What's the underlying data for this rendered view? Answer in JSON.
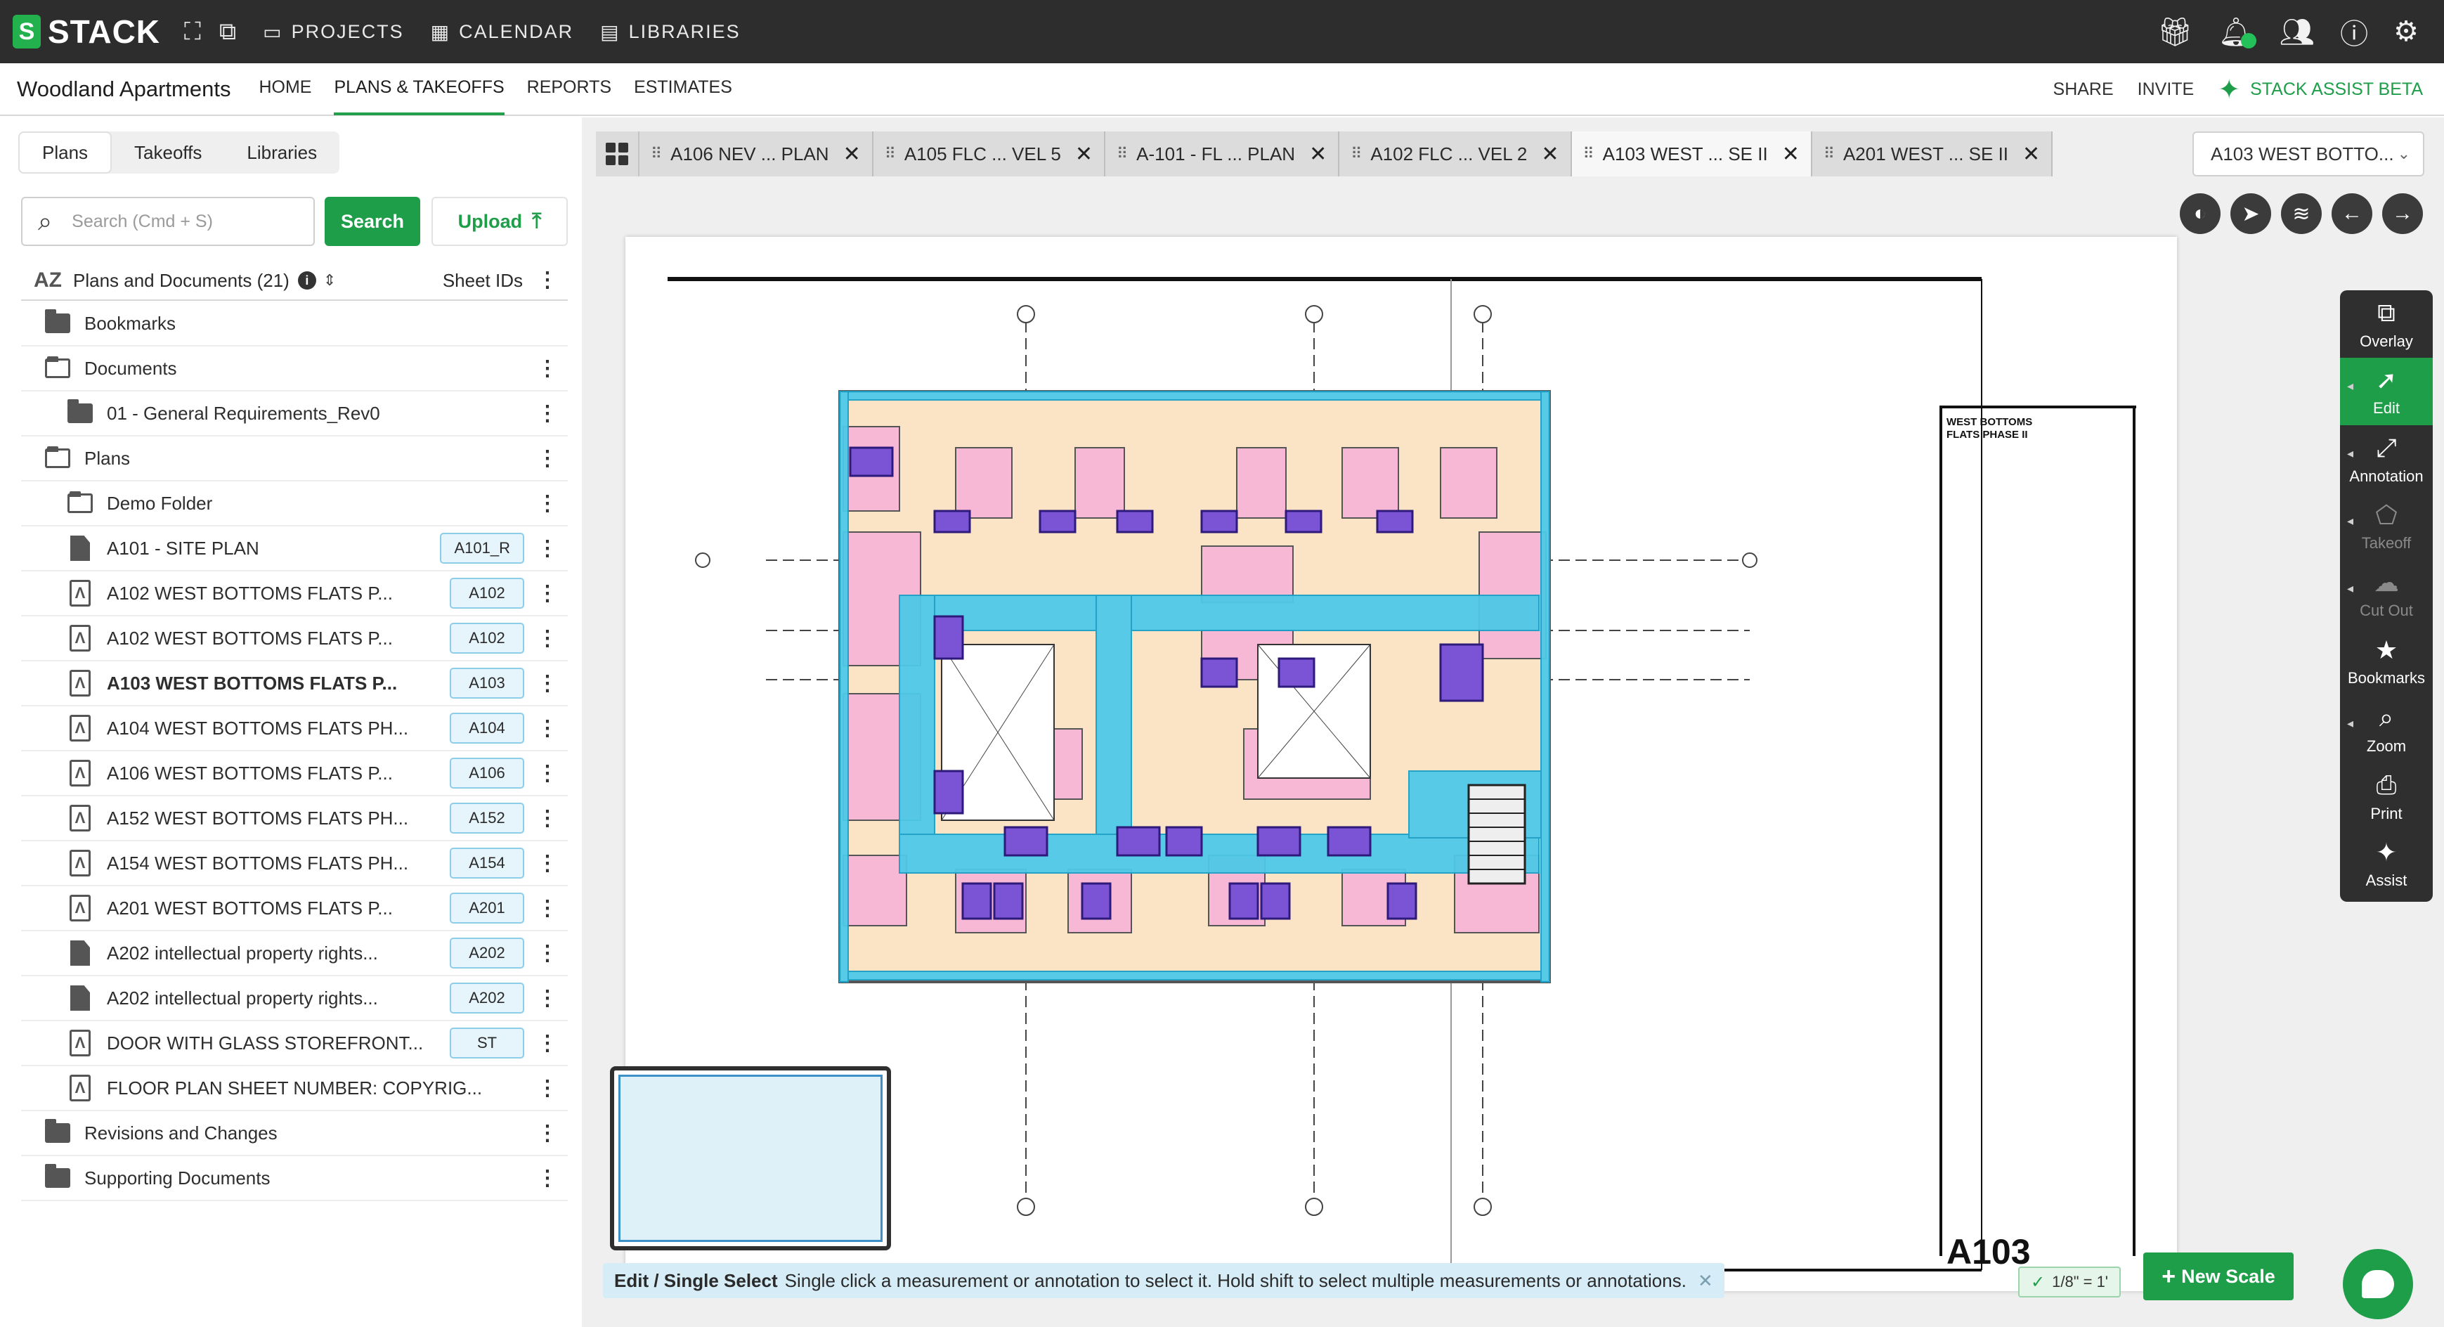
{
  "brand": {
    "logo_text": "STACK",
    "accent": "#1f9e4a",
    "nav_bg": "#2d2d2d"
  },
  "topnav": {
    "items": [
      {
        "label": "PROJECTS",
        "icon": "briefcase-icon"
      },
      {
        "label": "CALENDAR",
        "icon": "calendar-icon"
      },
      {
        "label": "LIBRARIES",
        "icon": "book-icon"
      }
    ],
    "right_icons": [
      "gift-icon",
      "bell-icon",
      "users-icon",
      "help-icon",
      "user-settings-icon"
    ]
  },
  "subbar": {
    "project_title": "Woodland Apartments",
    "tabs": [
      "HOME",
      "PLANS & TAKEOFFS",
      "REPORTS",
      "ESTIMATES"
    ],
    "active_tab": "PLANS & TAKEOFFS",
    "share": "SHARE",
    "invite": "INVITE",
    "assist": "STACK ASSIST BETA"
  },
  "left": {
    "tabs": [
      "Plans",
      "Takeoffs",
      "Libraries"
    ],
    "active_tab": "Plans",
    "search_placeholder": "Search (Cmd + S)",
    "search_button": "Search",
    "upload_button": "Upload",
    "list_title": "Plans and Documents (21)",
    "sheet_ids_label": "Sheet IDs",
    "rows": [
      {
        "label": "Bookmarks",
        "type": "folder",
        "indent": 1,
        "kebab": false
      },
      {
        "label": "Documents",
        "type": "folder-open",
        "indent": 1,
        "kebab": true
      },
      {
        "label": "01 - General Requirements_Rev0",
        "type": "folder",
        "indent": 2,
        "kebab": true
      },
      {
        "label": "Plans",
        "type": "folder-open",
        "indent": 1,
        "kebab": true
      },
      {
        "label": "Demo Folder",
        "type": "folder-open",
        "indent": 2,
        "kebab": true
      },
      {
        "label": "A101 - SITE PLAN",
        "type": "page",
        "indent": 2,
        "badge": "A101_R",
        "kebab": true
      },
      {
        "label": "A102 WEST BOTTOMS FLATS P...",
        "type": "plan",
        "indent": 2,
        "badge": "A102",
        "kebab": true
      },
      {
        "label": "A102 WEST BOTTOMS FLATS P...",
        "type": "plan",
        "indent": 2,
        "badge": "A102",
        "kebab": true
      },
      {
        "label": "A103 WEST BOTTOMS FLATS P...",
        "type": "plan",
        "indent": 2,
        "badge": "A103",
        "kebab": true,
        "bold": true
      },
      {
        "label": "A104 WEST BOTTOMS FLATS PH...",
        "type": "plan",
        "indent": 2,
        "badge": "A104",
        "kebab": true
      },
      {
        "label": "A106 WEST BOTTOMS FLATS P...",
        "type": "plan",
        "indent": 2,
        "badge": "A106",
        "kebab": true
      },
      {
        "label": "A152 WEST BOTTOMS FLATS PH...",
        "type": "plan",
        "indent": 2,
        "badge": "A152",
        "kebab": true
      },
      {
        "label": "A154 WEST BOTTOMS FLATS PH...",
        "type": "plan",
        "indent": 2,
        "badge": "A154",
        "kebab": true
      },
      {
        "label": "A201 WEST BOTTOMS FLATS P...",
        "type": "plan",
        "indent": 2,
        "badge": "A201",
        "kebab": true
      },
      {
        "label": "A202 intellectual property rights...",
        "type": "page",
        "indent": 2,
        "badge": "A202",
        "kebab": true
      },
      {
        "label": "A202 intellectual property rights...",
        "type": "page",
        "indent": 2,
        "badge": "A202",
        "kebab": true
      },
      {
        "label": "DOOR WITH GLASS STOREFRONT...",
        "type": "plan",
        "indent": 2,
        "badge": "ST",
        "kebab": true
      },
      {
        "label": "FLOOR PLAN SHEET NUMBER: COPYRIG...",
        "type": "plan",
        "indent": 2,
        "kebab": true
      },
      {
        "label": "Revisions and Changes",
        "type": "folder",
        "indent": 1,
        "kebab": true
      },
      {
        "label": "Supporting Documents",
        "type": "folder",
        "indent": 1,
        "kebab": true
      }
    ]
  },
  "viewer": {
    "sheet_tabs": [
      {
        "label": "A106 NEV ... PLAN",
        "active": false
      },
      {
        "label": "A105 FLC ... VEL 5",
        "active": false
      },
      {
        "label": "A-101 - FL​ ... PLAN",
        "active": false
      },
      {
        "label": "A102 FLC ... VEL 2",
        "active": false
      },
      {
        "label": "A103 WEST ... SE II",
        "active": true
      },
      {
        "label": "A201 WEST ... SE II",
        "active": false
      }
    ],
    "sheet_select": "A103 WEST BOTTO...",
    "view_tools": [
      "contrast-icon",
      "compass-icon",
      "layers-icon",
      "arrow-left-icon",
      "arrow-right-icon"
    ],
    "toolbar": [
      {
        "label": "Overlay",
        "icon": "overlay-icon",
        "state": "normal"
      },
      {
        "label": "Edit",
        "icon": "cursor-icon",
        "state": "active"
      },
      {
        "label": "Annotation",
        "icon": "annotation-icon",
        "state": "normal"
      },
      {
        "label": "Takeoff",
        "icon": "takeoff-icon",
        "state": "disabled"
      },
      {
        "label": "Cut Out",
        "icon": "cutout-icon",
        "state": "disabled"
      },
      {
        "label": "Bookmarks",
        "icon": "star-icon",
        "state": "normal"
      },
      {
        "label": "Zoom",
        "icon": "zoom-icon",
        "state": "normal"
      },
      {
        "label": "Print",
        "icon": "printer-icon",
        "state": "normal"
      },
      {
        "label": "Assist",
        "icon": "sparkle-icon",
        "state": "normal"
      }
    ],
    "title_block": {
      "project": "WEST BOTTOMS FLATS PHASE II",
      "sheet_number": "A103"
    },
    "hint_bold": "Edit / Single Select",
    "hint_text": "Single click a measurement or annotation to select it. Hold shift to select multiple measurements or annotations.",
    "scale_chip": "1/8\" = 1'",
    "new_scale_button": "New Scale"
  }
}
